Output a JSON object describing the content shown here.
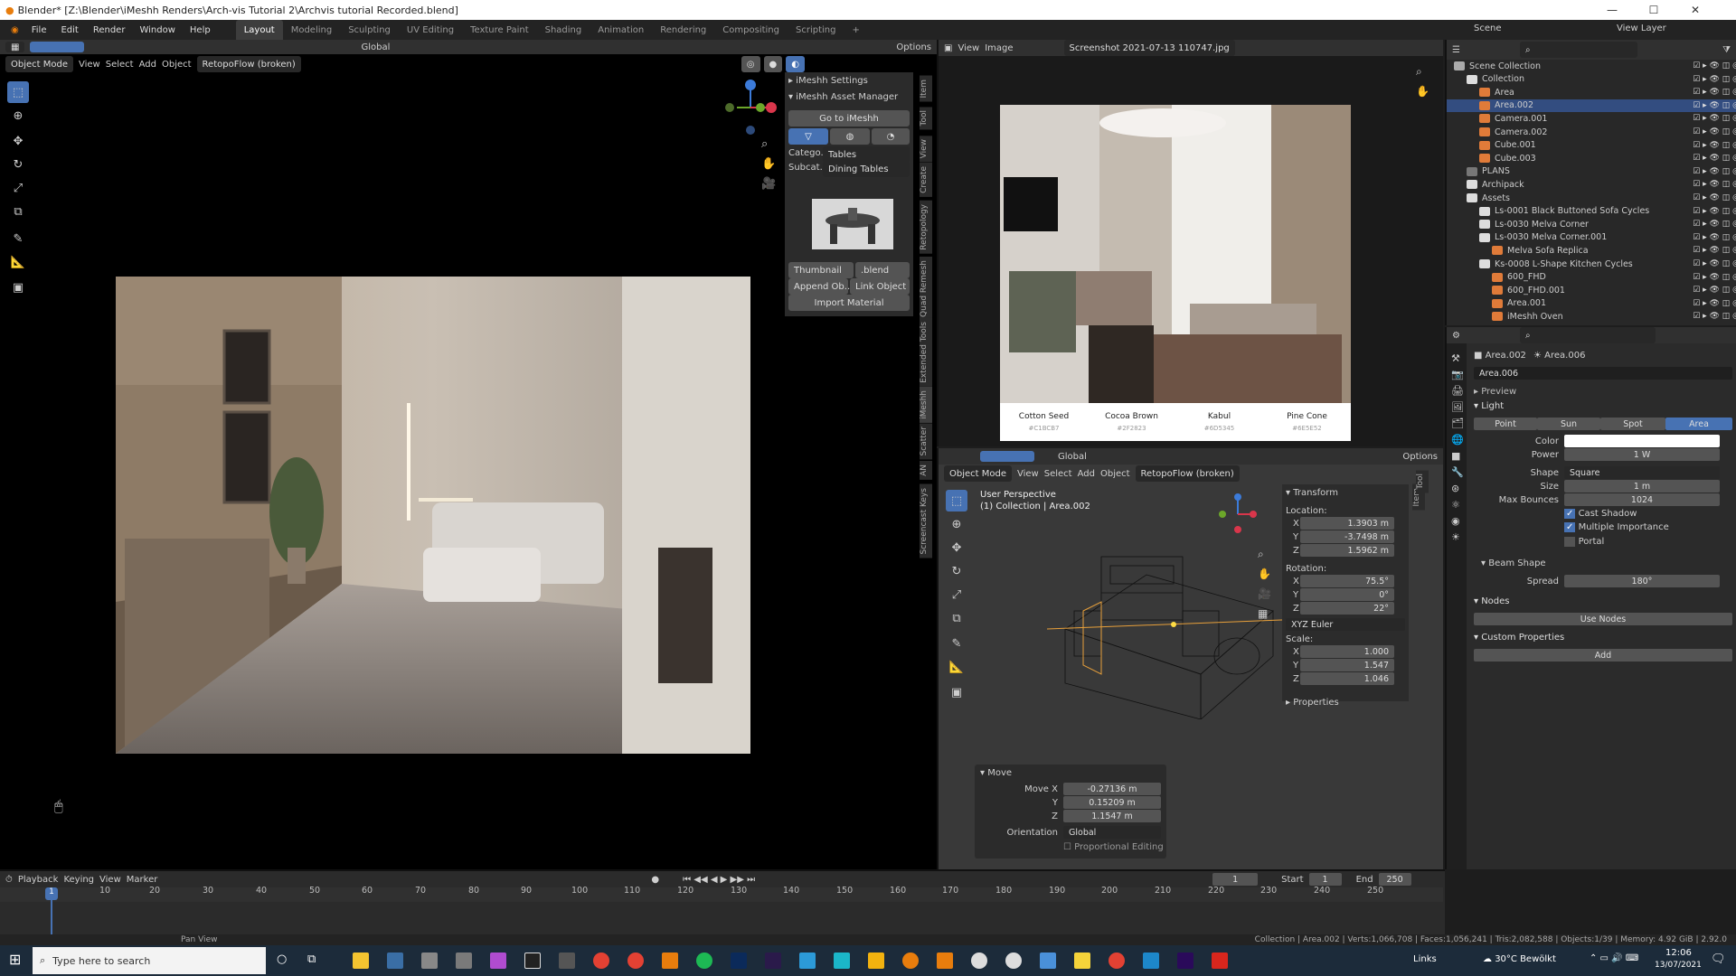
{
  "title_bar": {
    "text": "Blender* [Z:\\Blender\\iMeshh Renders\\Arch-vis Tutorial 2\\Archvis tutorial Recorded.blend]",
    "min": "—",
    "max": "☐",
    "close": "✕"
  },
  "menu": [
    "File",
    "Edit",
    "Render",
    "Window",
    "Help"
  ],
  "workspaces": [
    "Layout",
    "Modeling",
    "Sculpting",
    "UV Editing",
    "Texture Paint",
    "Shading",
    "Animation",
    "Rendering",
    "Compositing",
    "Scripting"
  ],
  "active_workspace": "Layout",
  "top_right": {
    "scene": "Scene",
    "view_layer": "View Layer"
  },
  "viewport_header": {
    "mode": "Object Mode",
    "view": "View",
    "select": "Select",
    "add": "Add",
    "object": "Object",
    "addon": "RetopoFlow (broken)",
    "orientation": "Global",
    "options": "Options"
  },
  "imeshh": {
    "settings": "iMeshh Settings",
    "asset_manager": "iMeshh Asset Manager",
    "goto": "Go to iMeshh",
    "category_label": "Catego...",
    "category_value": "Tables",
    "subcat_label": "Subcat...",
    "subcat_value": "Dining Tables",
    "thumbnail": "Thumbnail",
    "blend": ".blend",
    "append": "Append Ob...",
    "link": "Link Object",
    "import_material": "Import Material"
  },
  "side_tabs": [
    "Item",
    "Tool",
    "View",
    "Create",
    "Retopology",
    "Quad Remesh",
    "Extended Tools",
    "iMeshh",
    "Scatter",
    "AN",
    "Screencast Keys"
  ],
  "image_editor": {
    "view": "View",
    "image": "Image",
    "filename": "Screenshot 2021-07-13 110747.jpg"
  },
  "swatches": [
    {
      "name": "Cotton Seed",
      "hex": "#C1BCB7",
      "color": "#c1bcb7"
    },
    {
      "name": "Cocoa Brown",
      "hex": "#2F2823",
      "color": "#2f2823"
    },
    {
      "name": "Kabul",
      "hex": "#6D5345",
      "color": "#6d5345"
    },
    {
      "name": "Pine Cone",
      "hex": "#6E5E52",
      "color": "#6e5e52"
    }
  ],
  "viewport2": {
    "mode": "Object Mode",
    "view": "View",
    "select": "Select",
    "add": "Add",
    "object": "Object",
    "addon": "RetopoFlow (broken)",
    "orientation": "Global",
    "options": "Options",
    "perspective": "User Perspective",
    "collection": "(1) Collection | Area.002"
  },
  "transform": {
    "title": "Transform",
    "location_label": "Location:",
    "loc": {
      "x": "1.3903 m",
      "y": "-3.7498 m",
      "z": "1.5962 m"
    },
    "rotation_label": "Rotation:",
    "rot": {
      "x": "75.5°",
      "y": "0°",
      "z": "22°"
    },
    "rot_mode": "XYZ Euler",
    "scale_label": "Scale:",
    "scale": {
      "x": "1.000",
      "y": "1.547",
      "z": "1.046"
    },
    "properties": "Properties",
    "axes": {
      "x": "X",
      "y": "Y",
      "z": "Z"
    }
  },
  "move_panel": {
    "title": "Move",
    "move_x_label": "Move X",
    "move_x": "-0.27136 m",
    "y_label": "Y",
    "y": "0.15209 m",
    "z_label": "Z",
    "z": "1.1547 m",
    "orientation_label": "Orientation",
    "orientation": "Global",
    "proportional": "Proportional Editing"
  },
  "outliner": {
    "rows": [
      {
        "name": "Scene Collection",
        "indent": 0,
        "color": "#aaaaaa"
      },
      {
        "name": "Collection",
        "indent": 1,
        "color": "#dddddd"
      },
      {
        "name": "Area",
        "indent": 2,
        "color": "#e07b39"
      },
      {
        "name": "Area.002",
        "indent": 2,
        "color": "#e07b39",
        "sel": true
      },
      {
        "name": "Camera.001",
        "indent": 2,
        "color": "#e07b39"
      },
      {
        "name": "Camera.002",
        "indent": 2,
        "color": "#e07b39"
      },
      {
        "name": "Cube.001",
        "indent": 2,
        "color": "#e07b39"
      },
      {
        "name": "Cube.003",
        "indent": 2,
        "color": "#e07b39"
      },
      {
        "name": "PLANS",
        "indent": 1,
        "color": "#777777"
      },
      {
        "name": "Archipack",
        "indent": 1,
        "color": "#dddddd"
      },
      {
        "name": "Assets",
        "indent": 1,
        "color": "#dddddd"
      },
      {
        "name": "Ls-0001 Black Buttoned Sofa Cycles",
        "indent": 2,
        "color": "#dddddd"
      },
      {
        "name": "Ls-0030 Melva Corner",
        "indent": 2,
        "color": "#dddddd"
      },
      {
        "name": "Ls-0030 Melva Corner.001",
        "indent": 2,
        "color": "#dddddd"
      },
      {
        "name": "Melva Sofa Replica",
        "indent": 3,
        "color": "#e07b39"
      },
      {
        "name": "Ks-0008 L-Shape Kitchen Cycles",
        "indent": 2,
        "color": "#dddddd"
      },
      {
        "name": "600_FHD",
        "indent": 3,
        "color": "#e07b39"
      },
      {
        "name": "600_FHD.001",
        "indent": 3,
        "color": "#e07b39"
      },
      {
        "name": "Area.001",
        "indent": 3,
        "color": "#e07b39"
      },
      {
        "name": "iMeshh Oven",
        "indent": 3,
        "color": "#e07b39"
      }
    ]
  },
  "properties": {
    "object": "Area.002",
    "data": "Area.006",
    "data_field": "Area.006",
    "preview": "Preview",
    "light": "Light",
    "light_types": [
      "Point",
      "Sun",
      "Spot",
      "Area"
    ],
    "active_type": "Area",
    "color_label": "Color",
    "power_label": "Power",
    "power": "1 W",
    "shape_label": "Shape",
    "shape": "Square",
    "size_label": "Size",
    "size": "1 m",
    "max_bounces_label": "Max Bounces",
    "max_bounces": "1024",
    "cast_shadow": "Cast Shadow",
    "multiple_importance": "Multiple Importance",
    "portal": "Portal",
    "beam_shape": "Beam Shape",
    "spread_label": "Spread",
    "spread": "180°",
    "nodes": "Nodes",
    "use_nodes": "Use Nodes",
    "custom_props": "Custom Properties",
    "add": "Add"
  },
  "timeline": {
    "playback": "Playback",
    "keying": "Keying",
    "view": "View",
    "marker": "Marker",
    "current": "1",
    "start_label": "Start",
    "start": "1",
    "end_label": "End",
    "end": "250",
    "ticks": [
      "1",
      "10",
      "20",
      "30",
      "40",
      "50",
      "60",
      "70",
      "80",
      "90",
      "100",
      "110",
      "120",
      "130",
      "140",
      "150",
      "160",
      "170",
      "180",
      "190",
      "200",
      "210",
      "220",
      "230",
      "240",
      "250"
    ]
  },
  "status_bar": {
    "pan": "Pan View",
    "info": "Collection | Area.002 | Verts:1,066,708 | Faces:1,056,241 | Tris:2,082,588 | Objects:1/39 | Memory: 4.92 GiB | 2.92.0"
  },
  "taskbar": {
    "search": "Type here to search",
    "links": "Links",
    "weather": "30°C  Bewölkt",
    "time": "12:06",
    "date": "13/07/2021"
  }
}
